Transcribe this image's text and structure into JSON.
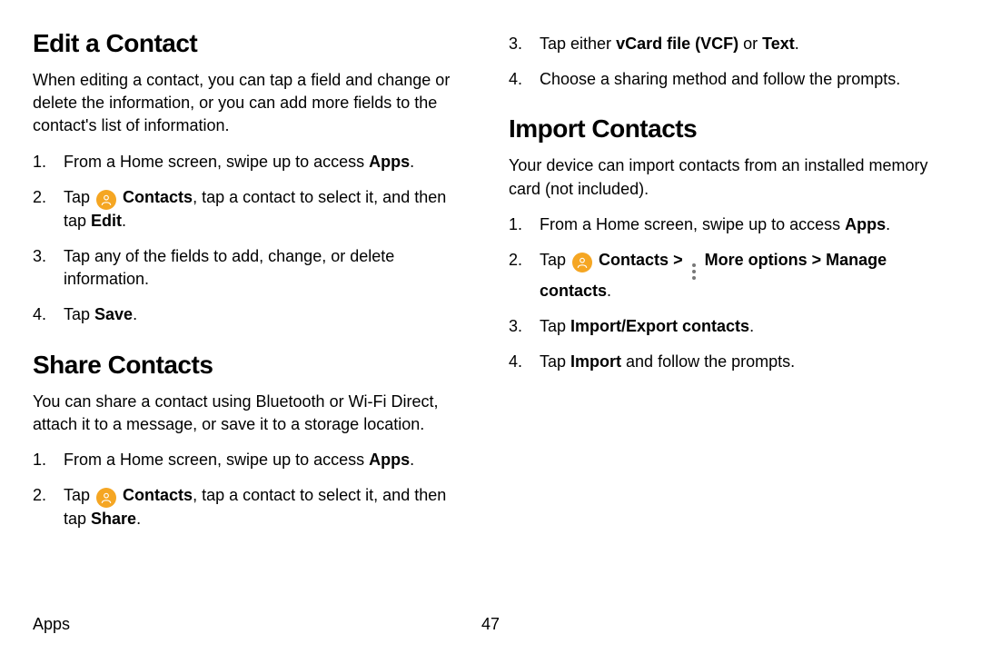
{
  "left": {
    "section1": {
      "title": "Edit a Contact",
      "intro": "When editing a contact, you can tap a field and change or delete the information, or you can add more fields to the contact's list of information.",
      "steps": {
        "s1_pre": "From a Home screen, swipe up to access ",
        "s1_b": "Apps",
        "s1_post": ".",
        "s2_pre": "Tap ",
        "s2_b1": "Contacts",
        "s2_mid": ", tap a contact to select it, and then tap ",
        "s2_b2": "Edit",
        "s2_post": ".",
        "s3": "Tap any of the fields to add, change, or delete information.",
        "s4_pre": "Tap ",
        "s4_b": "Save",
        "s4_post": "."
      }
    },
    "section2": {
      "title": "Share Contacts",
      "intro": "You can share a contact using Bluetooth or Wi-Fi Direct, attach it to a message, or save it to a storage location.",
      "steps": {
        "s1_pre": "From a Home screen, swipe up to access ",
        "s1_b": "Apps",
        "s1_post": ".",
        "s2_pre": "Tap ",
        "s2_b1": "Contacts",
        "s2_mid": ", tap a contact to select it, and then tap ",
        "s2_b2": "Share",
        "s2_post": "."
      }
    }
  },
  "right": {
    "cont": {
      "s3_pre": "Tap either ",
      "s3_b": "vCard file (VCF)",
      "s3_mid": " or ",
      "s3_b2": "Text",
      "s3_post": ".",
      "s4": "Choose a sharing method and follow the prompts."
    },
    "section1": {
      "title": "Import Contacts",
      "intro": "Your device can import contacts from an installed memory card (not included).",
      "steps": {
        "s1_pre": "From a Home screen, swipe up to access ",
        "s1_b": "Apps",
        "s1_post": ".",
        "s2_pre": "Tap ",
        "s2_b1": "Contacts",
        "s2_chev": ">",
        "s2_b2": "More options",
        "s2_b3": "Manage contacts",
        "s2_post": ".",
        "s3_pre": "Tap ",
        "s3_b": "Import/Export contacts",
        "s3_post": ".",
        "s4_pre": "Tap ",
        "s4_b": "Import",
        "s4_post": " and follow the prompts."
      }
    }
  },
  "footer": {
    "section": "Apps",
    "page": "47"
  },
  "nums": {
    "n1": "1.",
    "n2": "2.",
    "n3": "3.",
    "n4": "4."
  }
}
